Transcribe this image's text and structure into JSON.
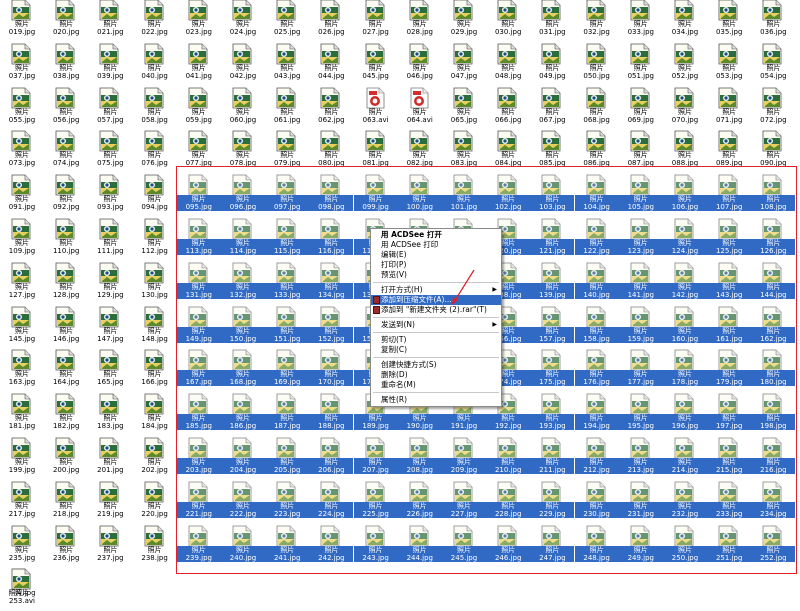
{
  "labels": {
    "photo_title": "照片",
    "photo_file_pattern": "{n}.jpg",
    "video_file_pattern": "{n}.avi",
    "last_item_label": "照片.jpg"
  },
  "files": {
    "first": 19,
    "last": 253,
    "video_numbers": [
      63,
      64,
      253
    ]
  },
  "colors": {
    "selection": "#316ac5",
    "marquee": "#e0202a",
    "arrow": "#e0202a"
  },
  "context_menu": {
    "items": [
      {
        "label": "用 ACDSee 打开",
        "bold": true
      },
      {
        "label": "用 ACDSee 打印"
      },
      {
        "label": "编辑(E)"
      },
      {
        "label": "打印(P)"
      },
      {
        "label": "预览(V)"
      },
      {
        "separator": true
      },
      {
        "label": "打开方式(H)",
        "submenu": true
      },
      {
        "label": "添加到压缩文件(A)...",
        "highlighted": true,
        "icon": "winrar-icon"
      },
      {
        "label": "添加到 \"新建文件夹 (2).rar\"(T)",
        "icon": "winrar-icon"
      },
      {
        "separator": true
      },
      {
        "label": "发送到(N)",
        "submenu": true
      },
      {
        "separator": true
      },
      {
        "label": "剪切(T)"
      },
      {
        "label": "复制(C)"
      },
      {
        "separator": true
      },
      {
        "label": "创建快捷方式(S)"
      },
      {
        "label": "删除(D)"
      },
      {
        "label": "重命名(M)"
      },
      {
        "separator": true
      },
      {
        "label": "属性(R)"
      }
    ]
  }
}
